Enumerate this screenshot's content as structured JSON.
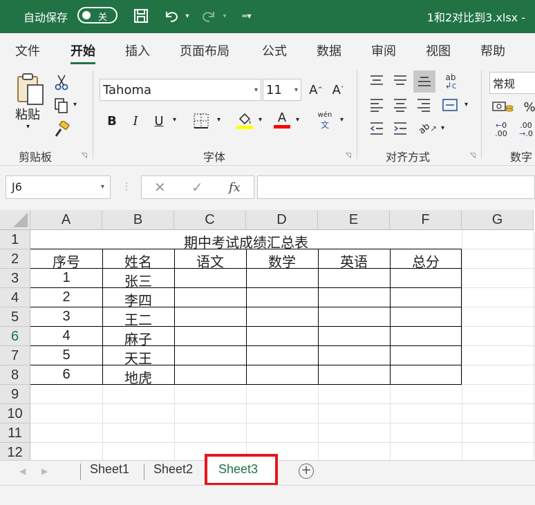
{
  "titlebar": {
    "autosave_label": "自动保存",
    "autosave_state": "关",
    "filename": "1和2对比到3.xlsx  -"
  },
  "ribbon_tabs": [
    "文件",
    "开始",
    "插入",
    "页面布局",
    "公式",
    "数据",
    "审阅",
    "视图",
    "帮助"
  ],
  "active_tab": "开始",
  "clipboard": {
    "paste_label": "粘贴",
    "group_label": "剪贴板"
  },
  "font": {
    "name": "Tahoma",
    "size": "11",
    "group_label": "字体",
    "phonetic_top": "wén",
    "phonetic_bottom": "文",
    "fill_color": "#ffff00",
    "font_color": "#ff0000"
  },
  "alignment": {
    "group_label": "对齐方式"
  },
  "number": {
    "format": "常规",
    "group_label": "数字"
  },
  "formula_bar": {
    "name_box": "J6",
    "cancel": "✕",
    "enter": "✓",
    "fx": "fx",
    "value": ""
  },
  "columns": [
    "A",
    "B",
    "C",
    "D",
    "E",
    "F",
    "G"
  ],
  "rows": [
    "1",
    "2",
    "3",
    "4",
    "5",
    "6",
    "7",
    "8",
    "9",
    "10",
    "11",
    "12"
  ],
  "selected_row": "6",
  "sheet": {
    "title": "期中考试成绩汇总表",
    "headers": [
      "序号",
      "姓名",
      "语文",
      "数学",
      "英语",
      "总分"
    ],
    "records": [
      [
        "1",
        "张三"
      ],
      [
        "2",
        "李四"
      ],
      [
        "3",
        "王二"
      ],
      [
        "4",
        "麻子"
      ],
      [
        "5",
        "天王"
      ],
      [
        "6",
        "地虎"
      ]
    ]
  },
  "sheet_tabs": [
    "Sheet1",
    "Sheet2",
    "Sheet3"
  ],
  "active_sheet": "Sheet3",
  "colors": {
    "excel_green": "#217346",
    "highlight_red": "#e8141e"
  }
}
